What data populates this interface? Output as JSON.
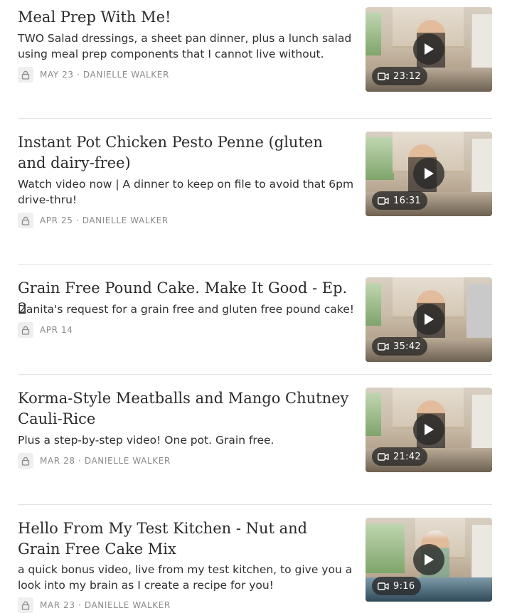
{
  "posts": [
    {
      "title": "Meal Prep With Me!",
      "subtitle": "TWO Salad dressings, a sheet pan dinner, plus a lunch salad using meal prep components that I cannot live without.",
      "meta": "MAY 23 · DANIELLE WALKER",
      "duration": "23:12"
    },
    {
      "title": "Instant Pot Chicken Pesto Penne (gluten and dairy-free)",
      "subtitle": "Watch video now | A dinner to keep on file to avoid that 6pm drive-thru!",
      "meta": "APR 25 · DANIELLE WALKER",
      "duration": "16:31"
    },
    {
      "title": "Grain Free Pound Cake. Make It Good - Ep. 2",
      "subtitle": "Danita's request for a grain free and gluten free pound cake!",
      "meta": "APR 14",
      "duration": "35:42"
    },
    {
      "title": "Korma-Style Meatballs and Mango Chutney Cauli-Rice",
      "subtitle": "Plus a step-by-step video! One pot. Grain free.",
      "meta": "MAR 28 · DANIELLE WALKER",
      "duration": "21:42"
    },
    {
      "title": "Hello From My Test Kitchen - Nut and Grain Free Cake Mix",
      "subtitle": "a quick bonus video, live from my test kitchen, to give you a look into my brain as I create a recipe for you!",
      "meta": "MAR 23 · DANIELLE WALKER",
      "duration": "9:16"
    }
  ],
  "icons": {
    "lock": "lock-icon",
    "play": "play-icon",
    "video": "video-camera-icon"
  },
  "colors": {
    "text": "#2b2b2b",
    "meta": "#8a8a8a",
    "divider": "#e3e3e3",
    "overlay": "#282828"
  }
}
